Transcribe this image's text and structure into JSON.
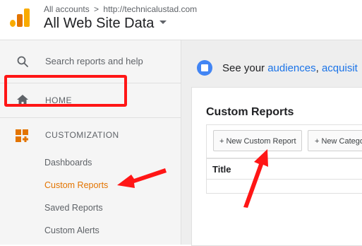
{
  "header": {
    "breadcrumb_accounts": "All accounts",
    "breadcrumb_separator": ">",
    "breadcrumb_site": "http://technicalustad.com",
    "account_name": "All Web Site Data"
  },
  "sidebar": {
    "search_placeholder": "Search reports and help",
    "home_label": "HOME",
    "customization_label": "CUSTOMIZATION",
    "items": [
      {
        "label": "Dashboards"
      },
      {
        "label": "Custom Reports"
      },
      {
        "label": "Saved Reports"
      },
      {
        "label": "Custom Alerts"
      }
    ]
  },
  "main": {
    "notice_prefix": "See your ",
    "notice_link1": "audiences",
    "notice_sep": ", ",
    "notice_link2": "acquisit",
    "card_title": "Custom Reports",
    "new_report_button": "+ New Custom Report",
    "new_category_button": "+ New Catego",
    "table_header_title": "Title"
  },
  "colors": {
    "accent_orange": "#e37400",
    "highlight_red": "#ff1616",
    "link_blue": "#1a73e8"
  },
  "icons": [
    "search-icon",
    "home-icon",
    "customization-icon",
    "notice-icon",
    "dropdown-caret-icon"
  ]
}
